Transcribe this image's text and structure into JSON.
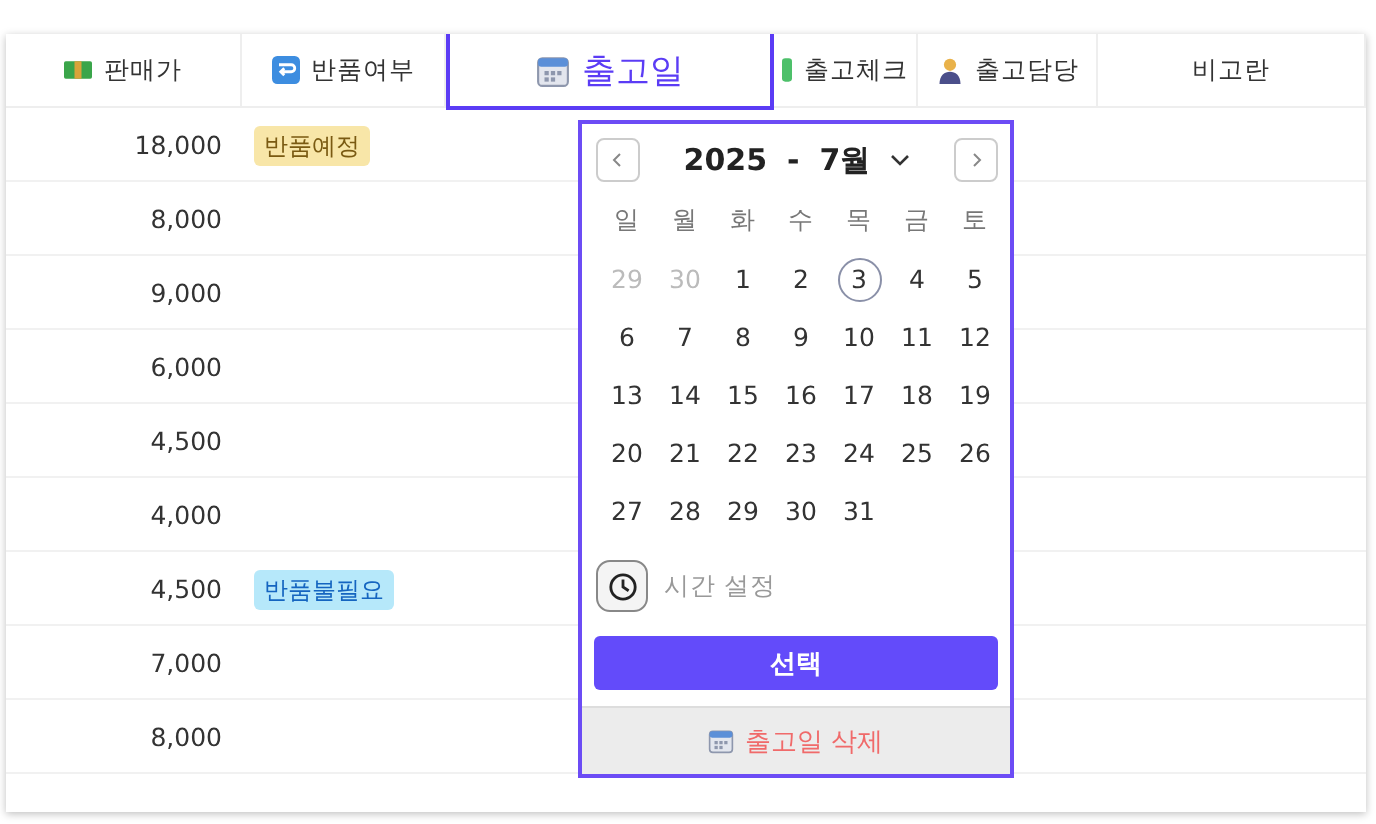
{
  "table": {
    "columns": [
      {
        "label": "판매가",
        "kind": "money",
        "selected": false
      },
      {
        "label": "반품여부",
        "kind": "return",
        "selected": false
      },
      {
        "label": "출고일",
        "kind": "calendar",
        "selected": true
      },
      {
        "label": "출고체크",
        "kind": "check",
        "selected": false
      },
      {
        "label": "출고담당",
        "kind": "person",
        "selected": false
      },
      {
        "label": "비고란",
        "kind": "plain",
        "selected": false
      }
    ],
    "rows": [
      {
        "price": "18,000",
        "badge": {
          "text": "반품예정",
          "kind": "pending"
        }
      },
      {
        "price": "8,000"
      },
      {
        "price": "9,000"
      },
      {
        "price": "6,000"
      },
      {
        "price": "4,500"
      },
      {
        "price": "4,000"
      },
      {
        "price": "4,500",
        "badge": {
          "text": "반품불필요",
          "kind": "unneeded"
        }
      },
      {
        "price": "7,000"
      },
      {
        "price": "8,000"
      }
    ]
  },
  "date_picker": {
    "year": "2025",
    "separator": "-",
    "month": "7월",
    "weekdays": [
      "일",
      "월",
      "화",
      "수",
      "목",
      "금",
      "토"
    ],
    "weeks": [
      [
        {
          "label": "29",
          "muted": true,
          "selected": false
        },
        {
          "label": "30",
          "muted": true,
          "selected": false
        },
        {
          "label": "1",
          "muted": false,
          "selected": false
        },
        {
          "label": "2",
          "muted": false,
          "selected": false
        },
        {
          "label": "3",
          "muted": false,
          "selected": true
        },
        {
          "label": "4",
          "muted": false,
          "selected": false
        },
        {
          "label": "5",
          "muted": false,
          "selected": false
        }
      ],
      [
        {
          "label": "6",
          "muted": false,
          "selected": false
        },
        {
          "label": "7",
          "muted": false,
          "selected": false
        },
        {
          "label": "8",
          "muted": false,
          "selected": false
        },
        {
          "label": "9",
          "muted": false,
          "selected": false
        },
        {
          "label": "10",
          "muted": false,
          "selected": false
        },
        {
          "label": "11",
          "muted": false,
          "selected": false
        },
        {
          "label": "12",
          "muted": false,
          "selected": false
        }
      ],
      [
        {
          "label": "13",
          "muted": false,
          "selected": false
        },
        {
          "label": "14",
          "muted": false,
          "selected": false
        },
        {
          "label": "15",
          "muted": false,
          "selected": false
        },
        {
          "label": "16",
          "muted": false,
          "selected": false
        },
        {
          "label": "17",
          "muted": false,
          "selected": false
        },
        {
          "label": "18",
          "muted": false,
          "selected": false
        },
        {
          "label": "19",
          "muted": false,
          "selected": false
        }
      ],
      [
        {
          "label": "20",
          "muted": false,
          "selected": false
        },
        {
          "label": "21",
          "muted": false,
          "selected": false
        },
        {
          "label": "22",
          "muted": false,
          "selected": false
        },
        {
          "label": "23",
          "muted": false,
          "selected": false
        },
        {
          "label": "24",
          "muted": false,
          "selected": false
        },
        {
          "label": "25",
          "muted": false,
          "selected": false
        },
        {
          "label": "26",
          "muted": false,
          "selected": false
        }
      ],
      [
        {
          "label": "27",
          "muted": false,
          "selected": false
        },
        {
          "label": "28",
          "muted": false,
          "selected": false
        },
        {
          "label": "29",
          "muted": false,
          "selected": false
        },
        {
          "label": "30",
          "muted": false,
          "selected": false
        },
        {
          "label": "31",
          "muted": false,
          "selected": false
        }
      ]
    ],
    "time_label": "시간 설정",
    "confirm": "선택",
    "delete": "출고일 삭제"
  }
}
